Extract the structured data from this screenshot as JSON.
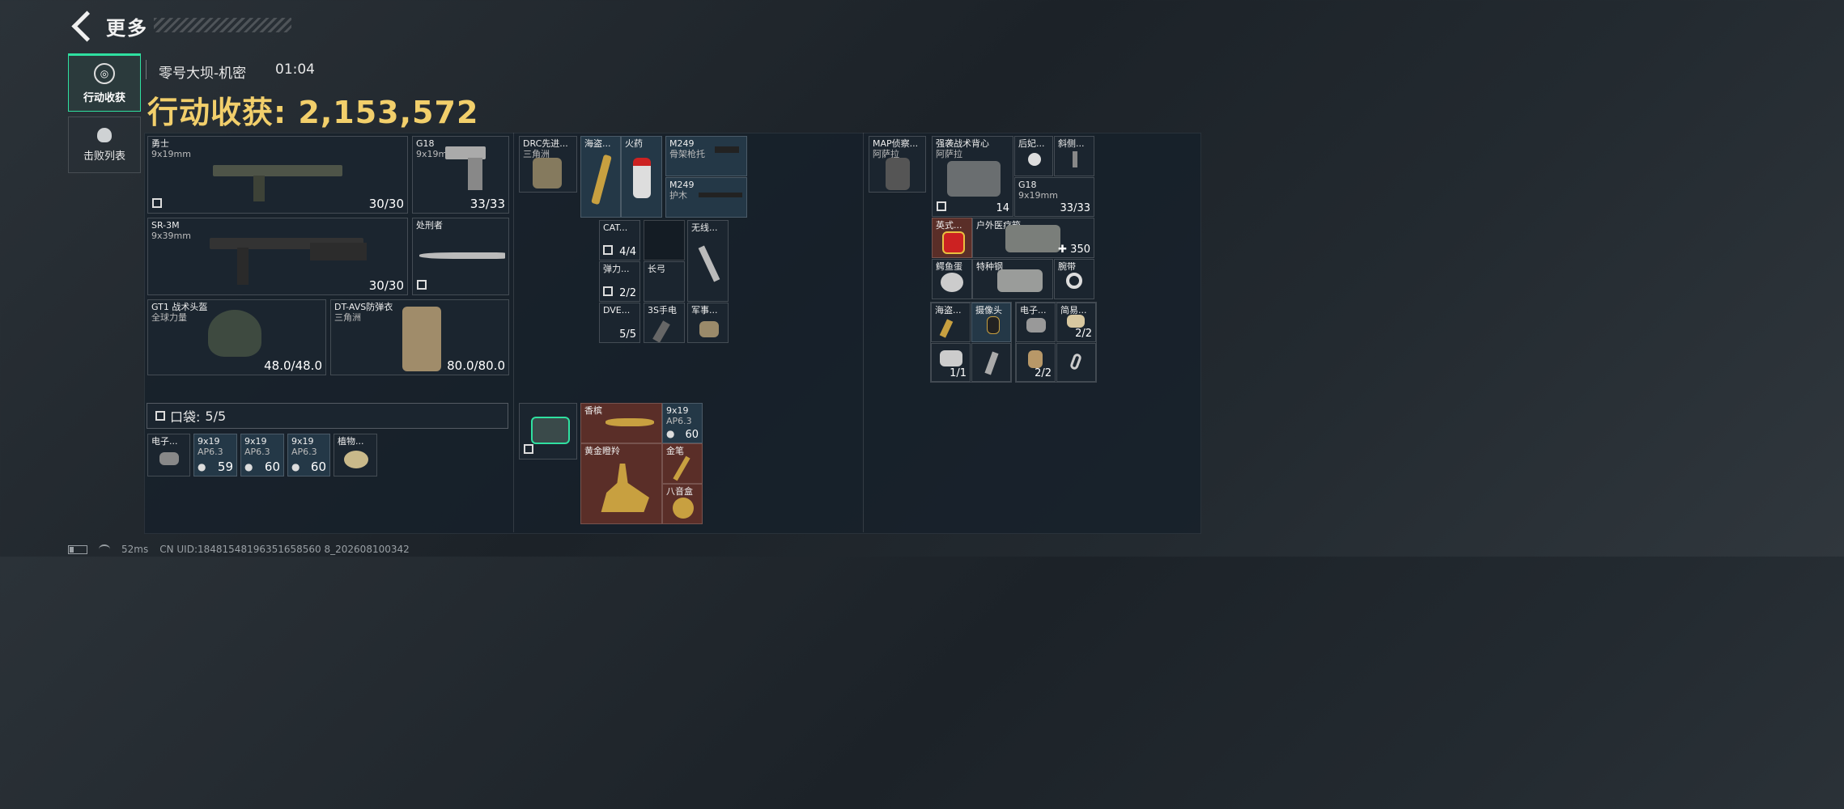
{
  "header": {
    "back_label": "更多"
  },
  "sidebar": {
    "tabs": [
      {
        "label": "行动收获",
        "icon": "target-icon",
        "active": true
      },
      {
        "label": "击败列表",
        "icon": "skull-icon",
        "active": false
      }
    ]
  },
  "raid": {
    "map": "零号大坝-机密",
    "time": "01:04",
    "total_label": "行动收获: 2,153,572"
  },
  "equipment": {
    "primary1": {
      "name": "勇士",
      "ammo": "9x19mm",
      "count": "30/30"
    },
    "secondary": {
      "name": "G18",
      "ammo": "9x19mm",
      "count": "33/33"
    },
    "primary2": {
      "name": "SR-3M",
      "ammo": "9x39mm",
      "count": "30/30"
    },
    "melee": {
      "name": "处刑者"
    },
    "helmet": {
      "name": "GT1 战术头盔",
      "brand": "全球力量",
      "durability": "48.0/48.0"
    },
    "armor": {
      "name": "DT-AVS防弹衣",
      "brand": "三角洲",
      "durability": "80.0/80.0"
    }
  },
  "pocket": {
    "label": "口袋:",
    "count": "5/5",
    "items": [
      {
        "name": "电子...",
        "count": ""
      },
      {
        "name": "9x19",
        "sub": "AP6.3",
        "count": "59"
      },
      {
        "name": "9x19",
        "sub": "AP6.3",
        "count": "60"
      },
      {
        "name": "9x19",
        "sub": "AP6.3",
        "count": "60"
      },
      {
        "name": "植物...",
        "count": ""
      }
    ]
  },
  "chest_rig": {
    "name": "DRC先进...",
    "brand": "三角洲",
    "items": [
      {
        "name": "海盗...",
        "count": ""
      },
      {
        "name": "火药",
        "count": ""
      },
      {
        "name": "M249",
        "sub": "骨架枪托",
        "count": ""
      },
      {
        "name": "M249",
        "sub": "护木",
        "count": ""
      },
      {
        "name": "CAT...",
        "count": "4/4"
      },
      {
        "name": "弹力...",
        "count": "2/2"
      },
      {
        "name": "长弓",
        "count": ""
      },
      {
        "name": "无线...",
        "count": ""
      },
      {
        "name": "DVE...",
        "count": "5/5"
      },
      {
        "name": "3S手电",
        "count": ""
      },
      {
        "name": "军事...",
        "count": ""
      }
    ]
  },
  "safe_box": {
    "items": [
      {
        "name": "香槟",
        "count": ""
      },
      {
        "name": "9x19",
        "sub": "AP6.3",
        "count": "60"
      },
      {
        "name": "黄金瞪羚",
        "count": ""
      },
      {
        "name": "金笔",
        "count": ""
      },
      {
        "name": "八音盒",
        "count": ""
      }
    ]
  },
  "backpack": {
    "name": "MAP侦察...",
    "brand": "阿萨拉",
    "items": [
      {
        "name": "强袭战术背心",
        "sub": "阿萨拉",
        "count": "14"
      },
      {
        "name": "后妃...",
        "count": ""
      },
      {
        "name": "斜侧...",
        "count": ""
      },
      {
        "name": "G18",
        "sub": "9x19mm",
        "count": "33/33"
      },
      {
        "name": "英式...",
        "count": ""
      },
      {
        "name": "户外医疗箱",
        "count": "350"
      },
      {
        "name": "鳄鱼蛋",
        "count": ""
      },
      {
        "name": "特种钢",
        "count": ""
      },
      {
        "name": "腕带",
        "count": ""
      },
      {
        "name": "海盗...",
        "count": ""
      },
      {
        "name": "摄像头",
        "count": ""
      },
      {
        "name": "电子...",
        "count": ""
      },
      {
        "name": "简易...",
        "count": "2/2"
      },
      {
        "name": "",
        "count": "1/1"
      },
      {
        "name": "",
        "count": ""
      },
      {
        "name": "",
        "count": "2/2"
      },
      {
        "name": "",
        "count": ""
      }
    ]
  },
  "footer": {
    "ping": "52ms",
    "uid": "CN UID:18481548196351658560 8_202608100342"
  }
}
